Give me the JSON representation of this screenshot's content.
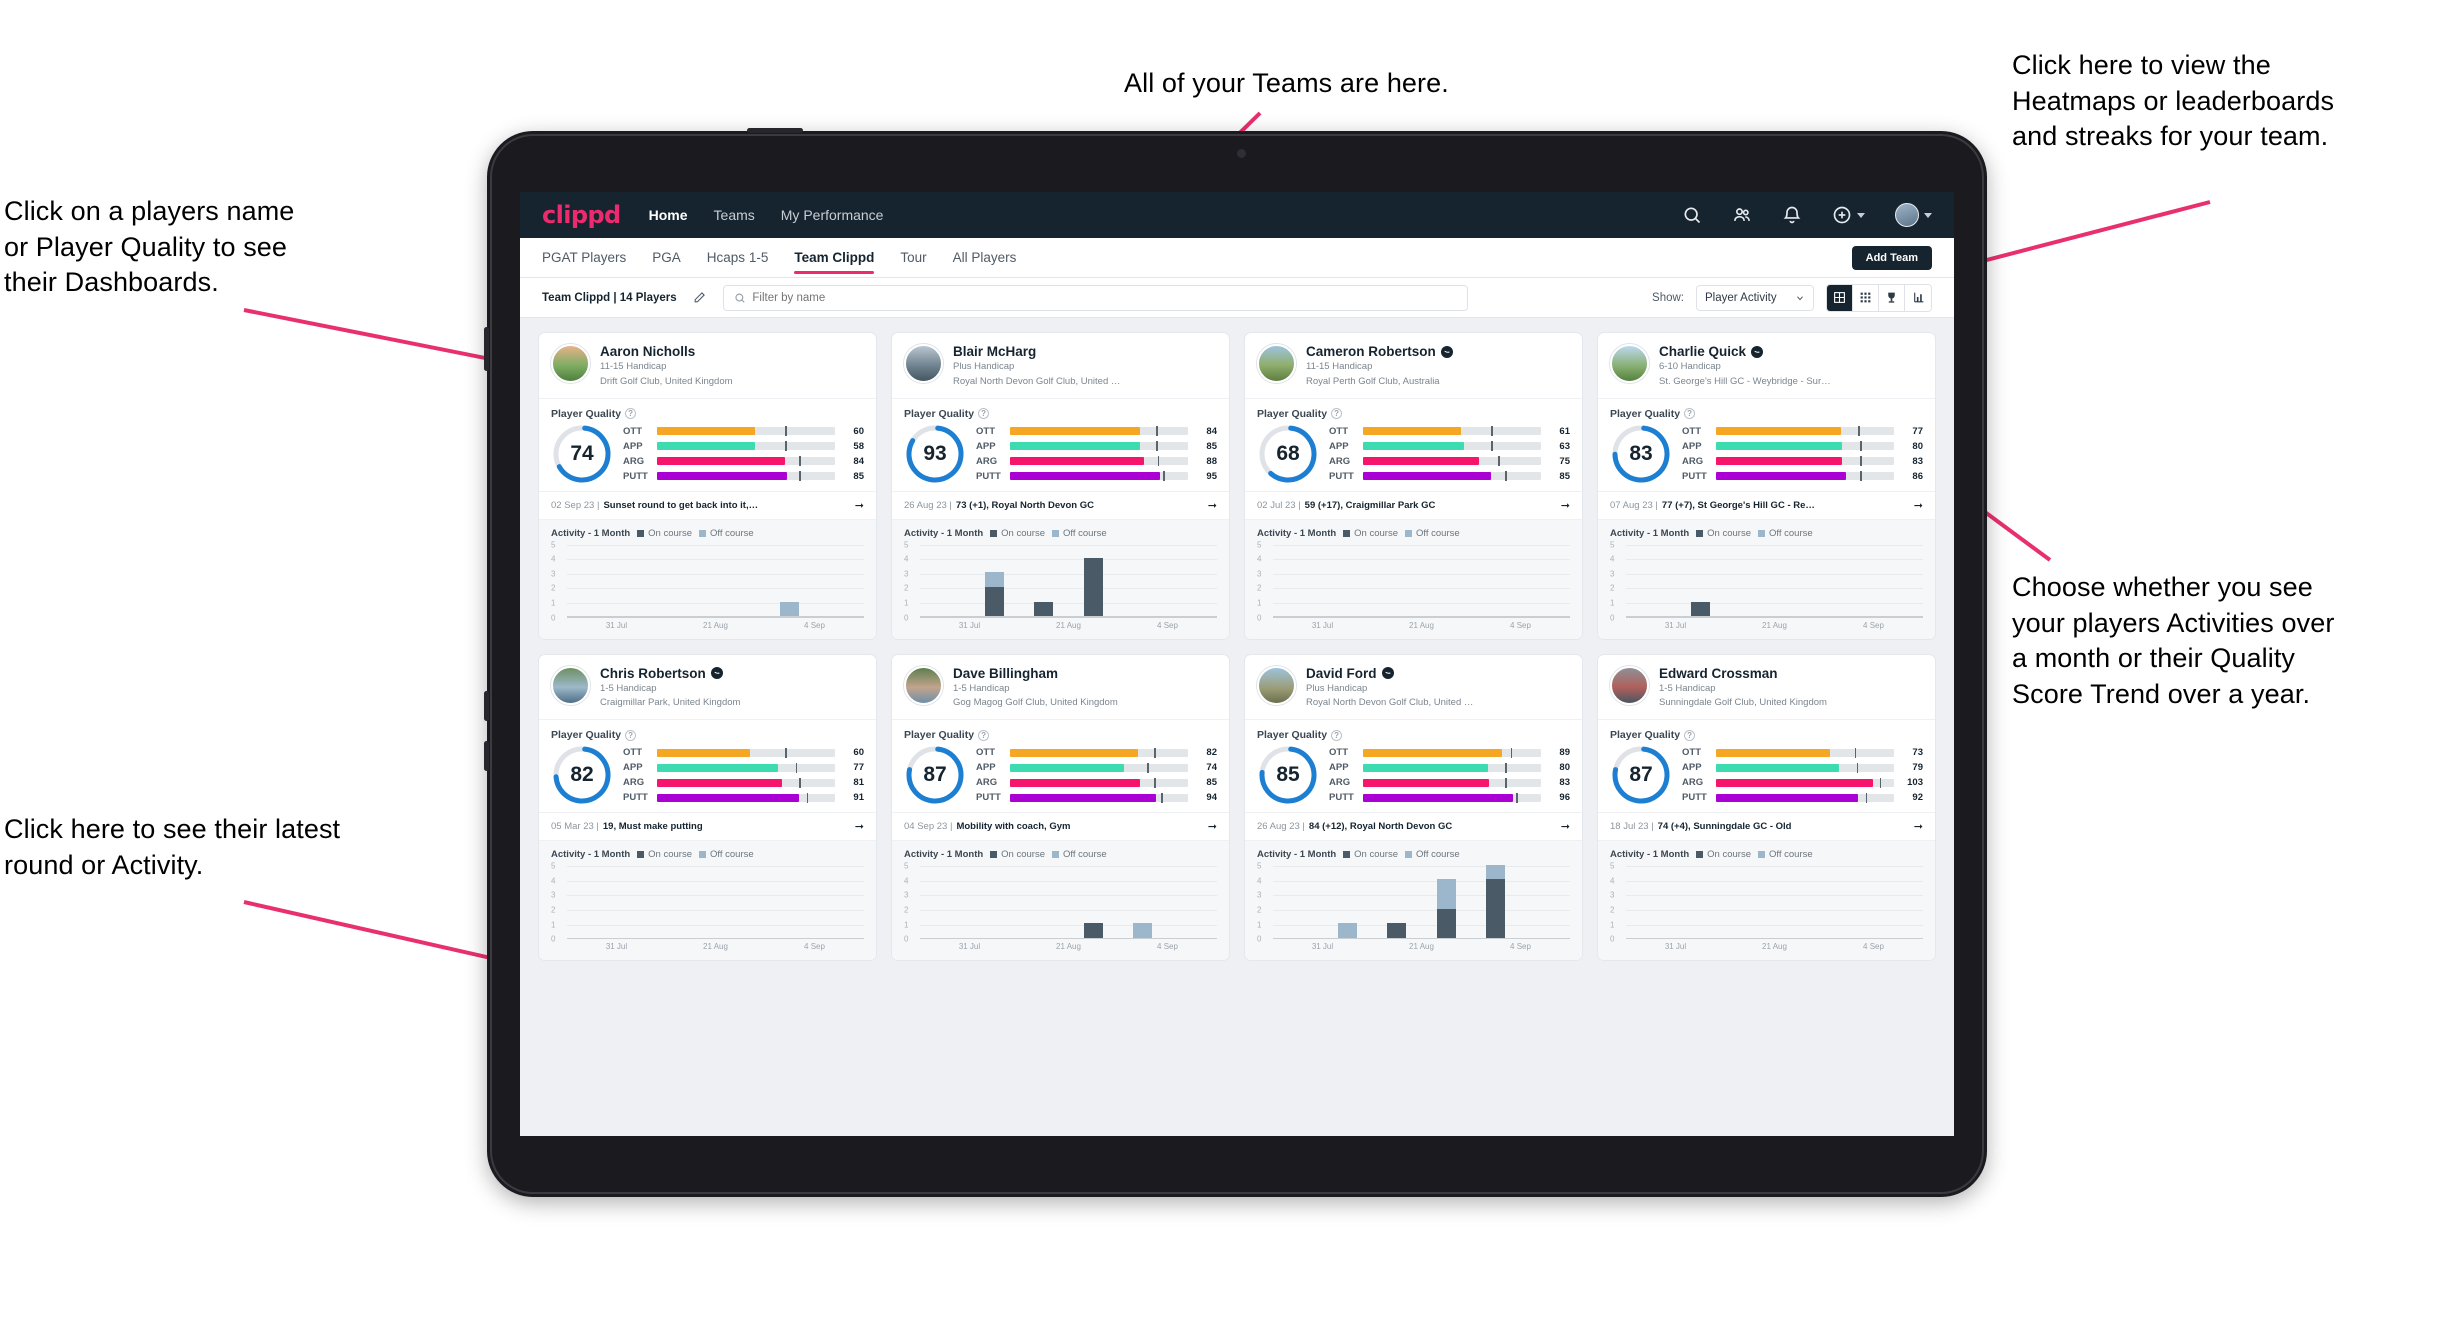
{
  "annotations": [
    {
      "id": "teams",
      "text": "All of your Teams are here."
    },
    {
      "id": "heatmaps",
      "text": "Click here to view the\nHeatmaps or leaderboards\nand streaks for your team."
    },
    {
      "id": "player-name",
      "text": "Click on a players name\nor Player Quality to see\ntheir Dashboards."
    },
    {
      "id": "activity-choice",
      "text": "Choose whether you see\nyour players Activities over\na month or their Quality\nScore Trend over a year."
    },
    {
      "id": "latest-round",
      "text": "Click here to see their latest\nround or Activity."
    }
  ],
  "navbar": {
    "logo": "clippd",
    "links": [
      {
        "label": "Home",
        "active": true
      },
      {
        "label": "Teams",
        "active": false
      },
      {
        "label": "My Performance",
        "active": false
      }
    ],
    "icons": [
      "search-icon",
      "people-icon",
      "bell-icon",
      "plus-circle-icon",
      "avatar"
    ]
  },
  "tabs": [
    {
      "label": "PGAT Players",
      "active": false
    },
    {
      "label": "PGA",
      "active": false
    },
    {
      "label": "Hcaps 1-5",
      "active": false
    },
    {
      "label": "Team Clippd",
      "active": true
    },
    {
      "label": "Tour",
      "active": false
    },
    {
      "label": "All Players",
      "active": false
    }
  ],
  "add_team_label": "Add Team",
  "toolbar": {
    "team_label": "Team Clippd | 14 Players",
    "edit_icon": "pencil-icon",
    "search_placeholder": "Filter by name",
    "search_value": "",
    "show_label": "Show:",
    "show_value": "Player Activity",
    "view_modes": [
      {
        "icon": "large-grid-icon",
        "active": true
      },
      {
        "icon": "small-grid-icon",
        "active": false
      },
      {
        "icon": "trophy-icon",
        "active": false
      },
      {
        "icon": "heatmap-icon",
        "active": false
      }
    ]
  },
  "card_labels": {
    "player_quality": "Player Quality",
    "activity": "Activity - 1 Month",
    "legend_on": "On course",
    "legend_off": "Off course",
    "metric_names": [
      "OTT",
      "APP",
      "ARG",
      "PUTT"
    ],
    "x_labels": [
      "31 Jul",
      "21 Aug",
      "4 Sep"
    ],
    "y_ticks": [
      "5",
      "4",
      "3",
      "2",
      "1",
      "0"
    ]
  },
  "metric_colors": {
    "OTT": "#f5a623",
    "APP": "#3ddbb0",
    "ARG": "#f5156c",
    "PUTT": "#aa00d4"
  },
  "colors": {
    "brand": "#ec2a6d",
    "navbar": "#16242f",
    "ring": "#1d7fd1",
    "on_course": "#4a5a67",
    "off_course": "#9cb6cc",
    "annotation_arrow": "#e8306d"
  },
  "players": [
    {
      "name": "Aaron Nicholls",
      "verified": false,
      "handicap": "11-15 Handicap",
      "club": "Drift Golf Club, United Kingdom",
      "quality": 74,
      "metrics": [
        {
          "label": "OTT",
          "value": 60,
          "fill": 55,
          "tick": 72
        },
        {
          "label": "APP",
          "value": 58,
          "fill": 55,
          "tick": 72
        },
        {
          "label": "ARG",
          "value": 84,
          "fill": 72,
          "tick": 80
        },
        {
          "label": "PUTT",
          "value": 85,
          "fill": 73,
          "tick": 80
        }
      ],
      "last_round": {
        "date": "02 Sep 23",
        "text": "Sunset round to get back into it, F..."
      },
      "activity": [
        {
          "on": 0,
          "off": 0
        },
        {
          "on": 0,
          "off": 0
        },
        {
          "on": 0,
          "off": 0
        },
        {
          "on": 0,
          "off": 0
        },
        {
          "on": 0,
          "off": 1
        },
        {
          "on": 0,
          "off": 0
        }
      ]
    },
    {
      "name": "Blair McHarg",
      "verified": false,
      "handicap": "Plus Handicap",
      "club": "Royal North Devon Golf Club, United Kin...",
      "quality": 93,
      "metrics": [
        {
          "label": "OTT",
          "value": 84,
          "fill": 73,
          "tick": 82
        },
        {
          "label": "APP",
          "value": 85,
          "fill": 73,
          "tick": 82
        },
        {
          "label": "ARG",
          "value": 88,
          "fill": 75,
          "tick": 83
        },
        {
          "label": "PUTT",
          "value": 95,
          "fill": 84,
          "tick": 86
        }
      ],
      "last_round": {
        "date": "26 Aug 23",
        "text": "73 (+1), Royal North Devon GC"
      },
      "activity": [
        {
          "on": 0,
          "off": 0
        },
        {
          "on": 2,
          "off": 1
        },
        {
          "on": 1,
          "off": 0
        },
        {
          "on": 4,
          "off": 0
        },
        {
          "on": 0,
          "off": 0
        },
        {
          "on": 0,
          "off": 0
        }
      ]
    },
    {
      "name": "Cameron Robertson",
      "verified": true,
      "handicap": "11-15 Handicap",
      "club": "Royal Perth Golf Club, Australia",
      "quality": 68,
      "metrics": [
        {
          "label": "OTT",
          "value": 61,
          "fill": 55,
          "tick": 72
        },
        {
          "label": "APP",
          "value": 63,
          "fill": 57,
          "tick": 72
        },
        {
          "label": "ARG",
          "value": 75,
          "fill": 65,
          "tick": 76
        },
        {
          "label": "PUTT",
          "value": 85,
          "fill": 72,
          "tick": 80
        }
      ],
      "last_round": {
        "date": "02 Jul 23",
        "text": "59 (+17), Craigmillar Park GC"
      },
      "activity": [
        {
          "on": 0,
          "off": 0
        },
        {
          "on": 0,
          "off": 0
        },
        {
          "on": 0,
          "off": 0
        },
        {
          "on": 0,
          "off": 0
        },
        {
          "on": 0,
          "off": 0
        },
        {
          "on": 0,
          "off": 0
        }
      ]
    },
    {
      "name": "Charlie Quick",
      "verified": true,
      "handicap": "6-10 Handicap",
      "club": "St. George's Hill GC - Weybridge - Surrey, ...",
      "quality": 83,
      "metrics": [
        {
          "label": "OTT",
          "value": 77,
          "fill": 70,
          "tick": 80
        },
        {
          "label": "APP",
          "value": 80,
          "fill": 71,
          "tick": 81
        },
        {
          "label": "ARG",
          "value": 83,
          "fill": 71,
          "tick": 81
        },
        {
          "label": "PUTT",
          "value": 86,
          "fill": 73,
          "tick": 81
        }
      ],
      "last_round": {
        "date": "07 Aug 23",
        "text": "77 (+7), St George's Hill GC - Red..."
      },
      "activity": [
        {
          "on": 0,
          "off": 0
        },
        {
          "on": 1,
          "off": 0
        },
        {
          "on": 0,
          "off": 0
        },
        {
          "on": 0,
          "off": 0
        },
        {
          "on": 0,
          "off": 0
        },
        {
          "on": 0,
          "off": 0
        }
      ]
    },
    {
      "name": "Chris Robertson",
      "verified": true,
      "handicap": "1-5 Handicap",
      "club": "Craigmillar Park, United Kingdom",
      "quality": 82,
      "metrics": [
        {
          "label": "OTT",
          "value": 60,
          "fill": 52,
          "tick": 72
        },
        {
          "label": "APP",
          "value": 77,
          "fill": 68,
          "tick": 78
        },
        {
          "label": "ARG",
          "value": 81,
          "fill": 70,
          "tick": 80
        },
        {
          "label": "PUTT",
          "value": 91,
          "fill": 80,
          "tick": 84
        }
      ],
      "last_round": {
        "date": "05 Mar 23",
        "text": "19, Must make putting"
      },
      "activity": [
        {
          "on": 0,
          "off": 0
        },
        {
          "on": 0,
          "off": 0
        },
        {
          "on": 0,
          "off": 0
        },
        {
          "on": 0,
          "off": 0
        },
        {
          "on": 0,
          "off": 0
        },
        {
          "on": 0,
          "off": 0
        }
      ]
    },
    {
      "name": "Dave Billingham",
      "verified": false,
      "handicap": "1-5 Handicap",
      "club": "Gog Magog Golf Club, United Kingdom",
      "quality": 87,
      "metrics": [
        {
          "label": "OTT",
          "value": 82,
          "fill": 72,
          "tick": 81
        },
        {
          "label": "APP",
          "value": 74,
          "fill": 64,
          "tick": 77
        },
        {
          "label": "ARG",
          "value": 85,
          "fill": 73,
          "tick": 81
        },
        {
          "label": "PUTT",
          "value": 94,
          "fill": 82,
          "tick": 85
        }
      ],
      "last_round": {
        "date": "04 Sep 23",
        "text": "Mobility with coach, Gym"
      },
      "activity": [
        {
          "on": 0,
          "off": 0
        },
        {
          "on": 0,
          "off": 0
        },
        {
          "on": 0,
          "off": 0
        },
        {
          "on": 1,
          "off": 0
        },
        {
          "on": 0,
          "off": 1
        },
        {
          "on": 0,
          "off": 0
        }
      ]
    },
    {
      "name": "David Ford",
      "verified": true,
      "handicap": "Plus Handicap",
      "club": "Royal North Devon Golf Club, United Kin...",
      "quality": 85,
      "metrics": [
        {
          "label": "OTT",
          "value": 89,
          "fill": 78,
          "tick": 83
        },
        {
          "label": "APP",
          "value": 80,
          "fill": 70,
          "tick": 80
        },
        {
          "label": "ARG",
          "value": 83,
          "fill": 71,
          "tick": 80
        },
        {
          "label": "PUTT",
          "value": 96,
          "fill": 84,
          "tick": 86
        }
      ],
      "last_round": {
        "date": "26 Aug 23",
        "text": "84 (+12), Royal North Devon GC"
      },
      "activity": [
        {
          "on": 0,
          "off": 0
        },
        {
          "on": 0,
          "off": 1
        },
        {
          "on": 1,
          "off": 0
        },
        {
          "on": 2,
          "off": 2
        },
        {
          "on": 4,
          "off": 1
        },
        {
          "on": 0,
          "off": 0
        }
      ]
    },
    {
      "name": "Edward Crossman",
      "verified": false,
      "handicap": "1-5 Handicap",
      "club": "Sunningdale Golf Club, United Kingdom",
      "quality": 87,
      "metrics": [
        {
          "label": "OTT",
          "value": 73,
          "fill": 64,
          "tick": 78
        },
        {
          "label": "APP",
          "value": 79,
          "fill": 69,
          "tick": 79
        },
        {
          "label": "ARG",
          "value": 103,
          "fill": 88,
          "tick": 92
        },
        {
          "label": "PUTT",
          "value": 92,
          "fill": 80,
          "tick": 84
        }
      ],
      "last_round": {
        "date": "18 Jul 23",
        "text": "74 (+4), Sunningdale GC - Old"
      },
      "activity": [
        {
          "on": 0,
          "off": 0
        },
        {
          "on": 0,
          "off": 0
        },
        {
          "on": 0,
          "off": 0
        },
        {
          "on": 0,
          "off": 0
        },
        {
          "on": 0,
          "off": 0
        },
        {
          "on": 0,
          "off": 0
        }
      ]
    }
  ]
}
